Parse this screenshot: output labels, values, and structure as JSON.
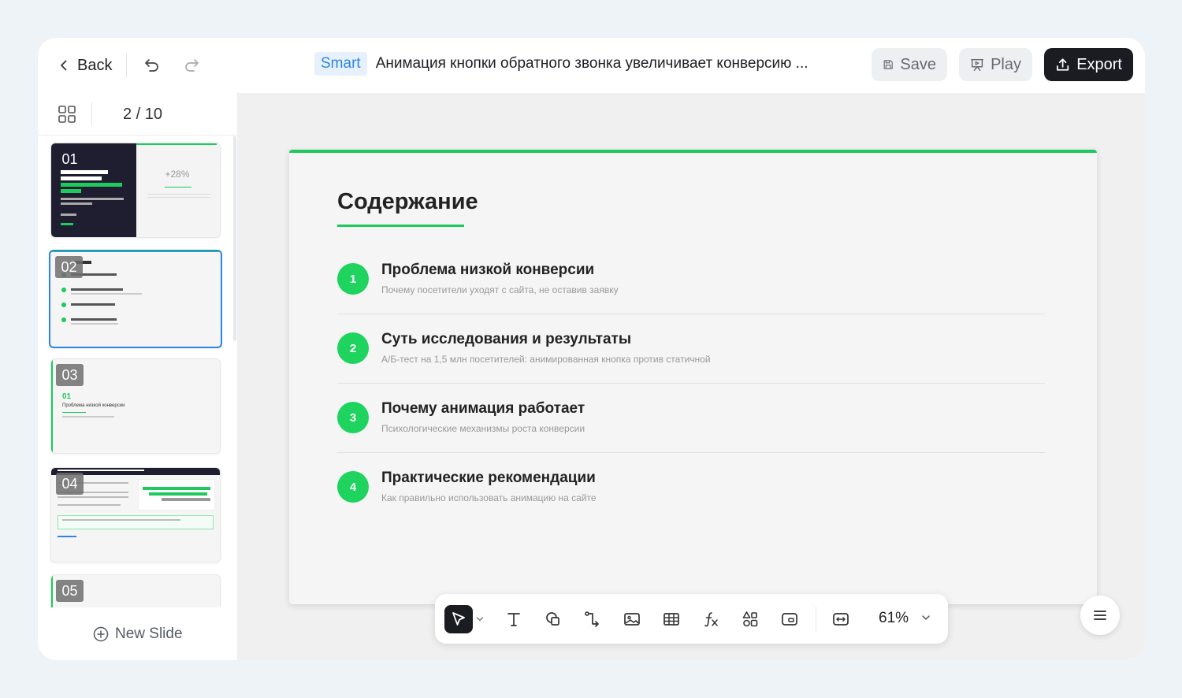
{
  "header": {
    "back_label": "Back",
    "badge": "Smart",
    "doc_title": "Анимация кнопки обратного звонка увеличивает конверсию ...",
    "save_label": "Save",
    "play_label": "Play",
    "export_label": "Export"
  },
  "sidebar": {
    "page_count": "2 / 10",
    "new_slide_label": "New Slide",
    "thumbs": [
      {
        "num": "01",
        "stat": "+28%"
      },
      {
        "num": "02"
      },
      {
        "num": "03",
        "label_num": "01",
        "label": "Проблема низкой конверсии"
      },
      {
        "num": "04"
      },
      {
        "num": "05"
      }
    ]
  },
  "slide": {
    "title": "Содержание",
    "items": [
      {
        "num": "1",
        "title": "Проблема низкой конверсии",
        "subtitle": "Почему посетители уходят с сайта, не оставив заявку"
      },
      {
        "num": "2",
        "title": "Суть исследования и результаты",
        "subtitle": "А/Б-тест на 1,5 млн посетителей: анимированная кнопка против статичной"
      },
      {
        "num": "3",
        "title": "Почему анимация работает",
        "subtitle": "Психологические механизмы роста конверсии"
      },
      {
        "num": "4",
        "title": "Практические рекомендации",
        "subtitle": "Как правильно использовать анимацию на сайте"
      }
    ]
  },
  "toolbar": {
    "zoom": "61%",
    "tools": [
      "select-tool-icon",
      "text-tool-icon",
      "shape-tool-icon",
      "connector-tool-icon",
      "image-tool-icon",
      "table-tool-icon",
      "formula-tool-icon",
      "elements-tool-icon",
      "media-tool-icon",
      "fit-width-icon"
    ]
  },
  "colors": {
    "accent_green": "#1ec95d",
    "selection_blue": "#2b84e6",
    "dark": "#1b1c22",
    "badge_bg": "#e6f1fb",
    "badge_text": "#2f86e0"
  }
}
